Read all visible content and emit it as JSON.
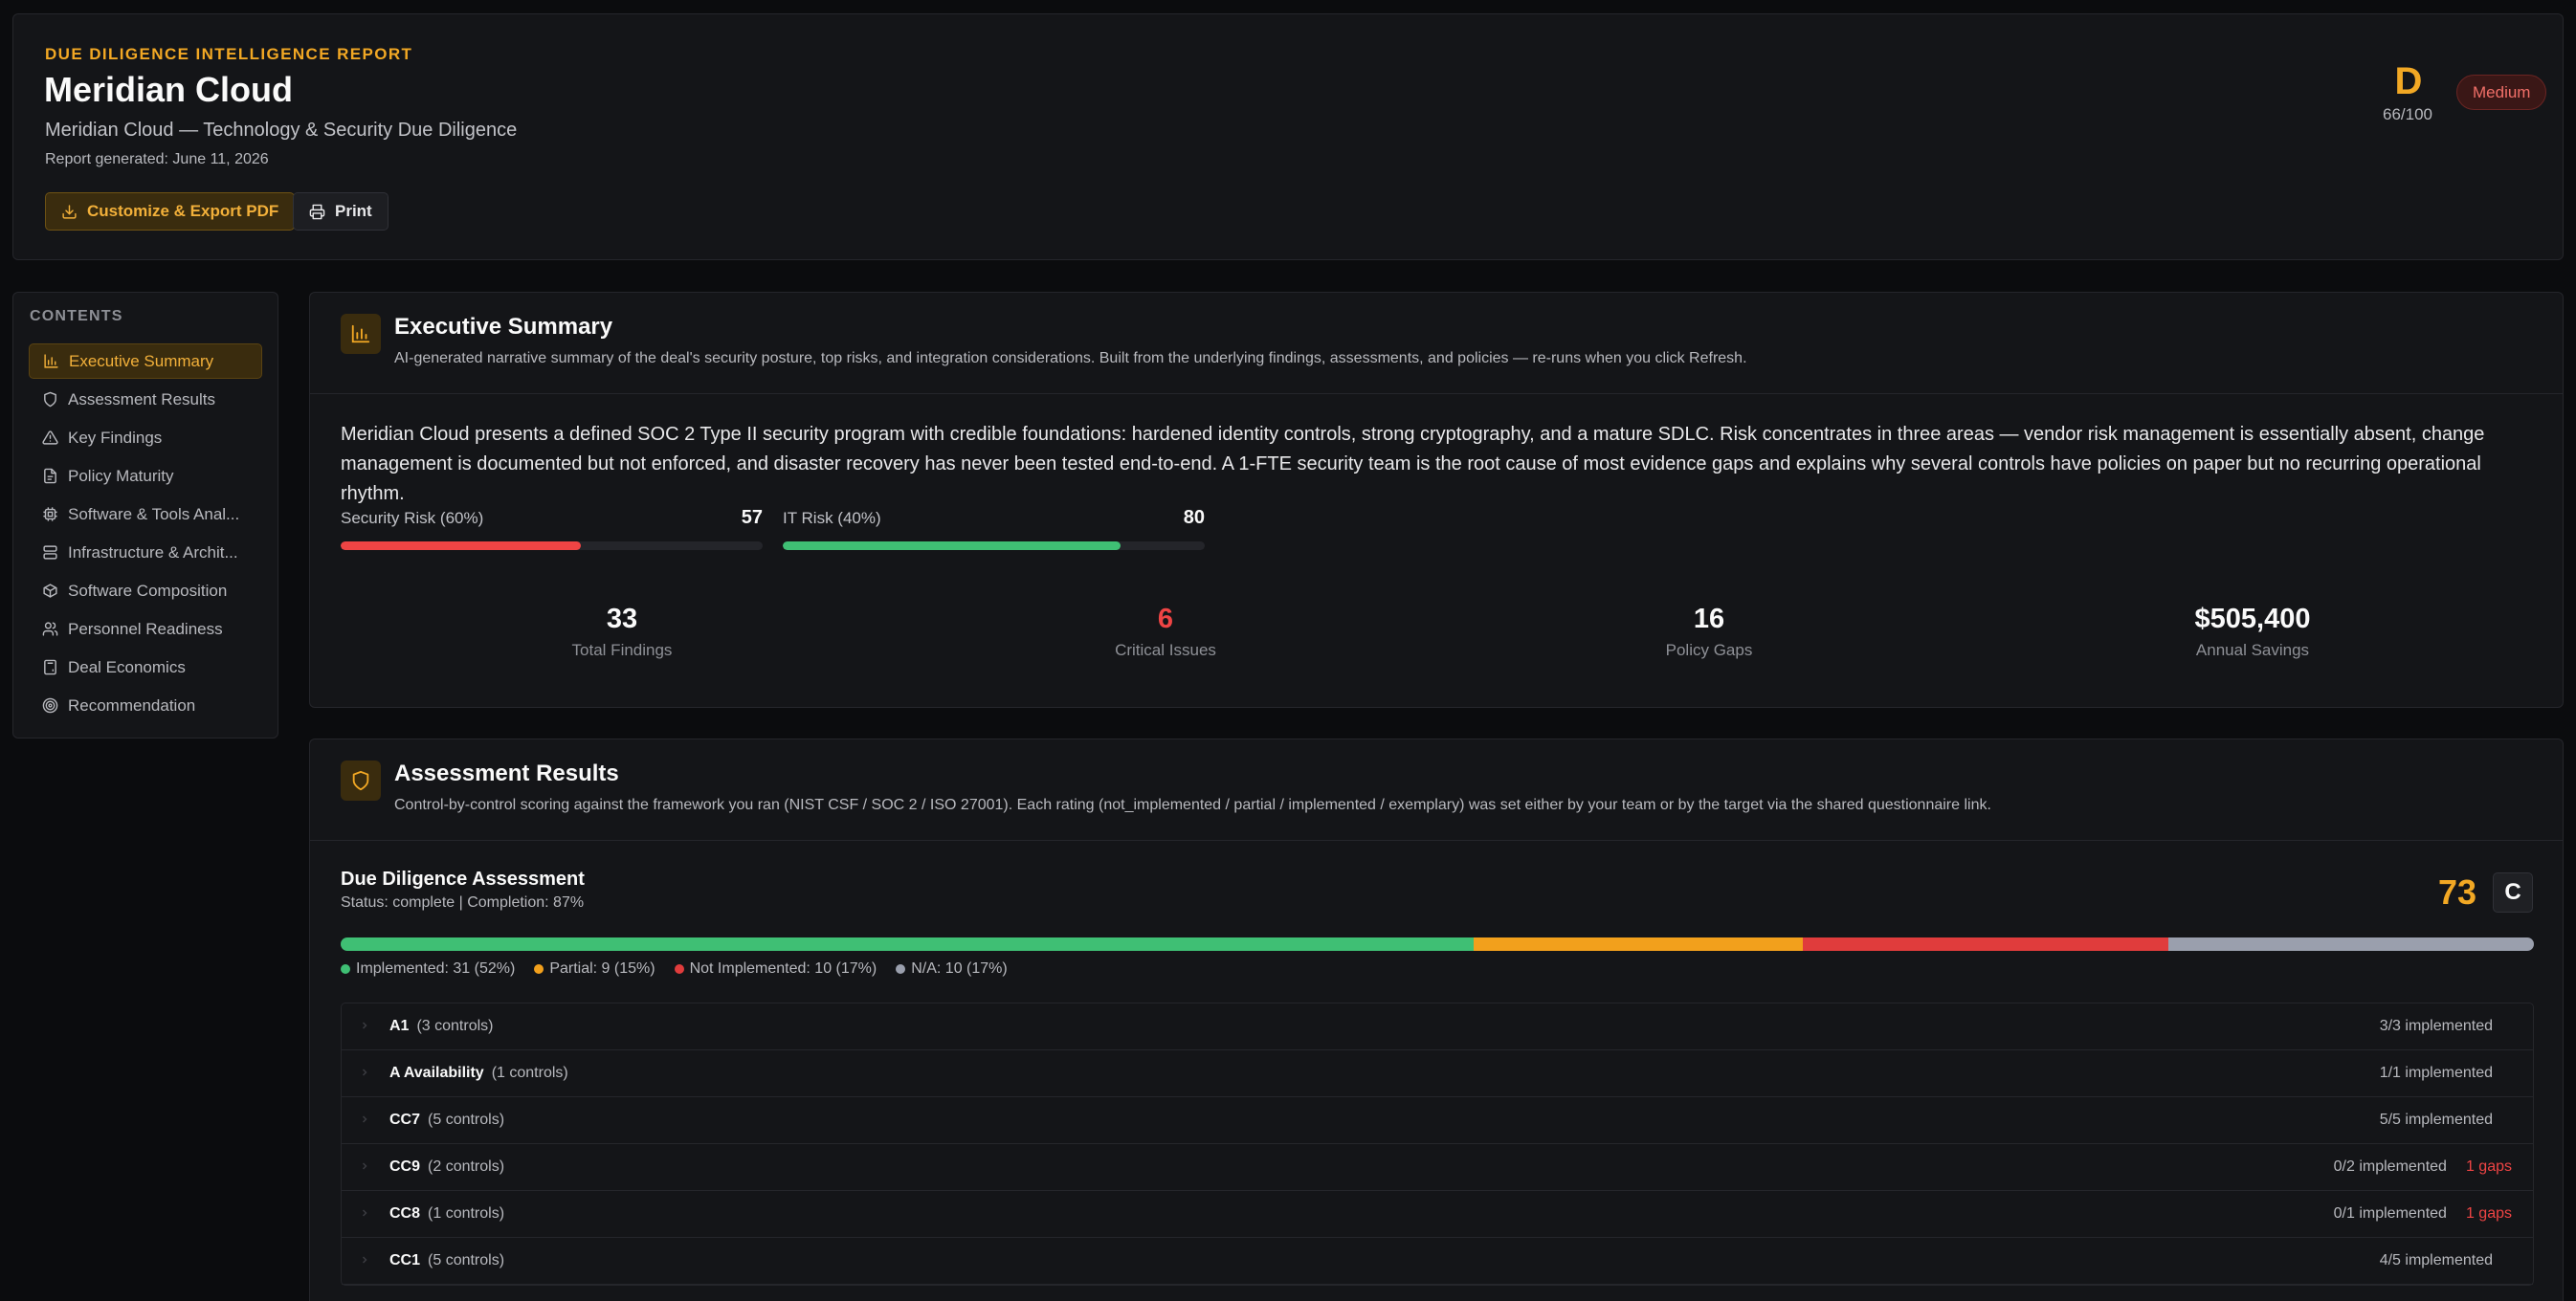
{
  "header": {
    "eyebrow": "DUE DILIGENCE INTELLIGENCE REPORT",
    "company": "Meridian Cloud",
    "subtitle": "Meridian Cloud — Technology & Security Due Diligence",
    "generated": "Report generated: June 11, 2026",
    "export_label": "Customize & Export PDF",
    "print_label": "Print",
    "grade": "D",
    "score": "66/100",
    "risk_level": "Medium"
  },
  "colors": {
    "accent": "#f2a824",
    "success": "#3fbf74",
    "warning": "#f2a824",
    "danger": "#ef4444",
    "neutral": "#9a9fad"
  },
  "sidebar": {
    "title": "CONTENTS",
    "items": [
      {
        "label": "Executive Summary",
        "icon": "bar-chart-icon"
      },
      {
        "label": "Assessment Results",
        "icon": "shield-icon"
      },
      {
        "label": "Key Findings",
        "icon": "warning-triangle-icon"
      },
      {
        "label": "Policy Maturity",
        "icon": "document-icon"
      },
      {
        "label": "Software & Tools Anal...",
        "icon": "cpu-icon"
      },
      {
        "label": "Infrastructure & Archit...",
        "icon": "server-icon"
      },
      {
        "label": "Software Composition",
        "icon": "package-icon"
      },
      {
        "label": "Personnel Readiness",
        "icon": "users-icon"
      },
      {
        "label": "Deal Economics",
        "icon": "calculator-icon"
      },
      {
        "label": "Recommendation",
        "icon": "target-icon"
      }
    ]
  },
  "executive": {
    "title": "Executive Summary",
    "description": "AI-generated narrative summary of the deal's security posture, top risks, and integration considerations. Built from the underlying findings, assessments, and policies — re-runs when you click Refresh.",
    "narrative": "Meridian Cloud presents a defined SOC 2 Type II security program with credible foundations: hardened identity controls, strong cryptography, and a mature SDLC. Risk concentrates in three areas — vendor risk management is essentially absent, change management is documented but not enforced, and disaster recovery has never been tested end-to-end. A 1-FTE security team is the root cause of most evidence gaps and explains why several controls have policies on paper but no recurring operational rhythm.",
    "security_risk": {
      "label": "Security Risk (60%)",
      "value": "57",
      "percent": 57
    },
    "it_risk": {
      "label": "IT Risk (40%)",
      "value": "80",
      "percent": 80
    },
    "stats": [
      {
        "value": "33",
        "label": "Total Findings"
      },
      {
        "value": "6",
        "label": "Critical Issues"
      },
      {
        "value": "16",
        "label": "Policy Gaps"
      },
      {
        "value": "$505,400",
        "label": "Annual Savings"
      }
    ]
  },
  "assessment": {
    "title": "Assessment Results",
    "description": "Control-by-control scoring against the framework you ran (NIST CSF / SOC 2 / ISO 27001). Each rating (not_implemented / partial / implemented / exemplary) was set either by your team or by the target via the shared questionnaire link.",
    "dd_title": "Due Diligence Assessment",
    "dd_status": "Status: complete | Completion: 87%",
    "score": "73",
    "grade": "C",
    "breakdown": [
      {
        "label": "Implemented: 31 (52%)",
        "count": 31
      },
      {
        "label": "Partial: 9 (15%)",
        "count": 9
      },
      {
        "label": "Not Implemented: 10 (17%)",
        "count": 10
      },
      {
        "label": "N/A: 10 (17%)",
        "count": 10
      }
    ],
    "groups": [
      {
        "name": "A1",
        "count": "(3 controls)",
        "status": "3/3 implemented",
        "gaps": ""
      },
      {
        "name": "A Availability",
        "count": "(1 controls)",
        "status": "1/1 implemented",
        "gaps": ""
      },
      {
        "name": "CC7",
        "count": "(5 controls)",
        "status": "5/5 implemented",
        "gaps": ""
      },
      {
        "name": "CC9",
        "count": "(2 controls)",
        "status": "0/2 implemented",
        "gaps": "1 gaps"
      },
      {
        "name": "CC8",
        "count": "(1 controls)",
        "status": "0/1 implemented",
        "gaps": "1 gaps"
      },
      {
        "name": "CC1",
        "count": "(5 controls)",
        "status": "4/5 implemented",
        "gaps": ""
      }
    ]
  }
}
